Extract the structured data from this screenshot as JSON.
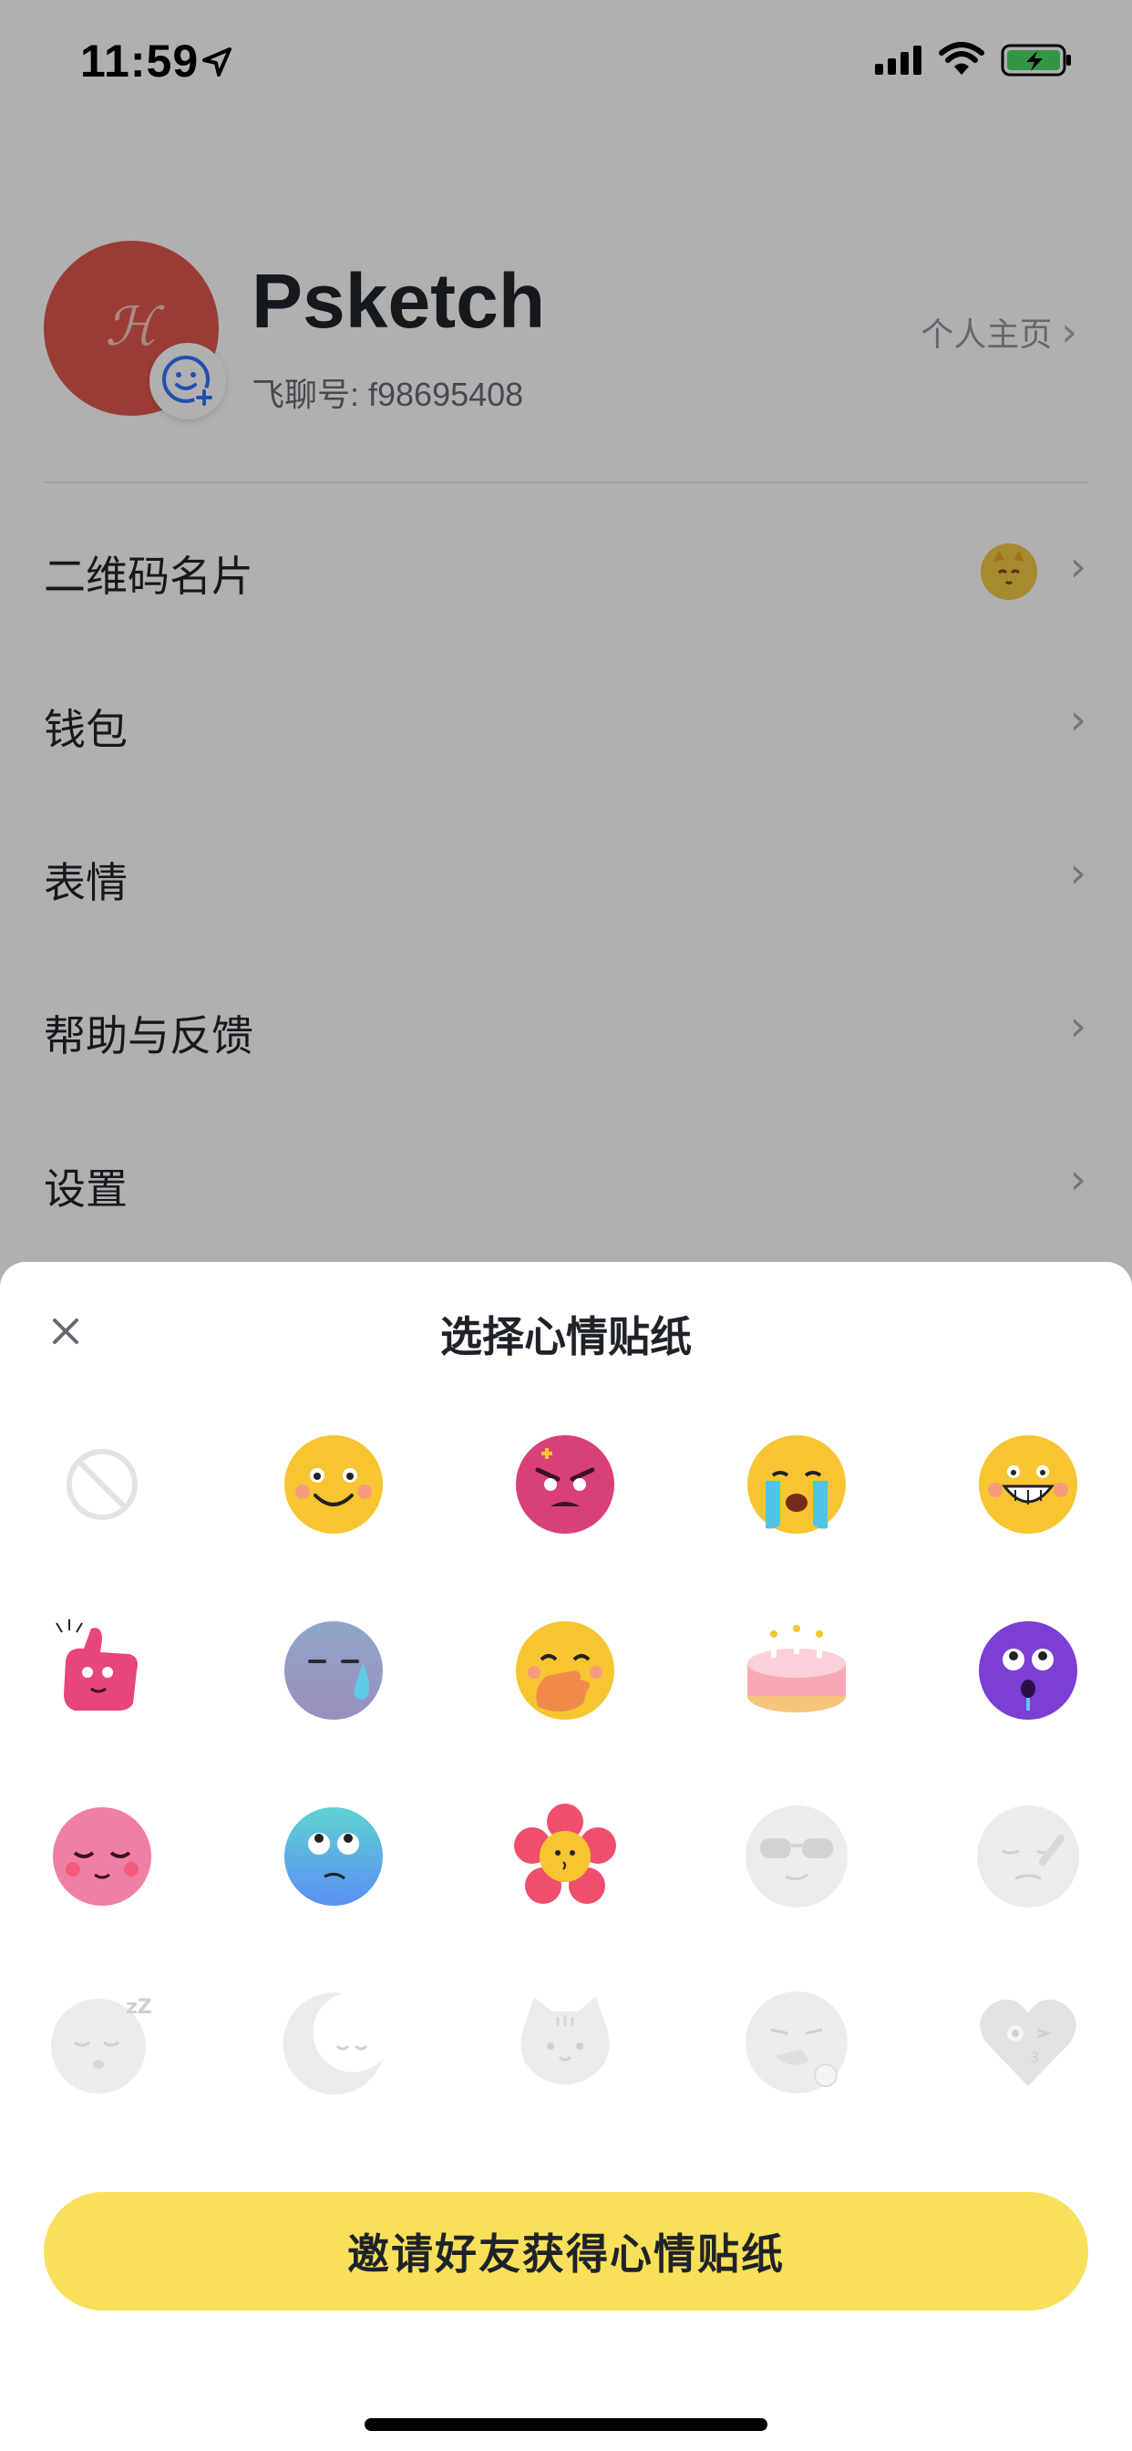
{
  "status_bar": {
    "time": "11:59"
  },
  "profile": {
    "name": "Psketch",
    "user_id": "飞聊号: f98695408",
    "homepage_link": "个人主页",
    "avatar_monogram": "ℋ"
  },
  "menu": {
    "items": [
      {
        "label": "二维码名片"
      },
      {
        "label": "钱包"
      },
      {
        "label": "表情"
      },
      {
        "label": "帮助与反馈"
      },
      {
        "label": "设置"
      }
    ]
  },
  "sheet": {
    "title": "选择心情贴纸",
    "invite_button": "邀请好友获得心情贴纸",
    "stickers": [
      {
        "name": "no-sticker-icon",
        "locked": false
      },
      {
        "name": "smile-sticker",
        "locked": false
      },
      {
        "name": "angry-sticker",
        "locked": false
      },
      {
        "name": "crying-sticker",
        "locked": false
      },
      {
        "name": "grin-sticker",
        "locked": false
      },
      {
        "name": "thumbs-up-sticker",
        "locked": false
      },
      {
        "name": "sweat-sticker",
        "locked": false
      },
      {
        "name": "hand-over-mouth-sticker",
        "locked": false
      },
      {
        "name": "birthday-cake-sticker",
        "locked": false
      },
      {
        "name": "shocked-purple-sticker",
        "locked": false
      },
      {
        "name": "blissful-pink-sticker",
        "locked": false
      },
      {
        "name": "eye-roll-sticker",
        "locked": false
      },
      {
        "name": "flower-sticker",
        "locked": false
      },
      {
        "name": "sunglasses-sticker",
        "locked": true
      },
      {
        "name": "bandaged-face-sticker",
        "locked": true
      },
      {
        "name": "sleeping-sticker",
        "locked": true
      },
      {
        "name": "moon-sticker",
        "locked": true
      },
      {
        "name": "cat-sticker",
        "locked": true
      },
      {
        "name": "watermelon-sticker",
        "locked": true
      },
      {
        "name": "heart-wink-sticker",
        "locked": true
      }
    ]
  },
  "colors": {
    "button_yellow": "#f9e05a",
    "avatar_red": "#e0574f",
    "overlay": "#000000"
  }
}
